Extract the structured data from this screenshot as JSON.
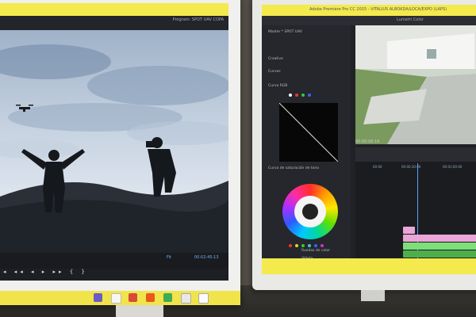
{
  "left_monitor": {
    "panel_header": "Program: SPOT UAV COPA",
    "timecode_left": "00:00:00:00",
    "zoom": "Fit",
    "timecode_right": "00:02:45:13",
    "playback_glyphs": "◂ ◂◂ ◂ ▸ ▸▸ { }"
  },
  "right_monitor": {
    "window_title": "Adobe Premiere Pro CC 2015 - VITALIUS ALBOKDA/LOCA/EXPO (LAPS)",
    "menu_hint": "Lumetri Color",
    "panel_labels": [
      "Creative",
      "Curves",
      "Curva RGB",
      "Curva de saturación de tono",
      "Ruedas de color",
      "Viñeta"
    ],
    "sequence_label": "Master * SPOT UAV",
    "timecode_program": "00:00:00:16",
    "fit_label": "Fit",
    "ruler_marks": [
      "00:00",
      "00:00:30:00",
      "00:01:00:00"
    ]
  },
  "colors": {
    "bezel_accent": "#f4ea4d",
    "premiere_dark": "#202226",
    "timeline_pink": "#e9a6d6",
    "timeline_green": "#7ddf7a",
    "timeline_blue": "#5b78c4"
  },
  "icons": [
    "drone-icon",
    "play-icon",
    "settings-icon"
  ]
}
